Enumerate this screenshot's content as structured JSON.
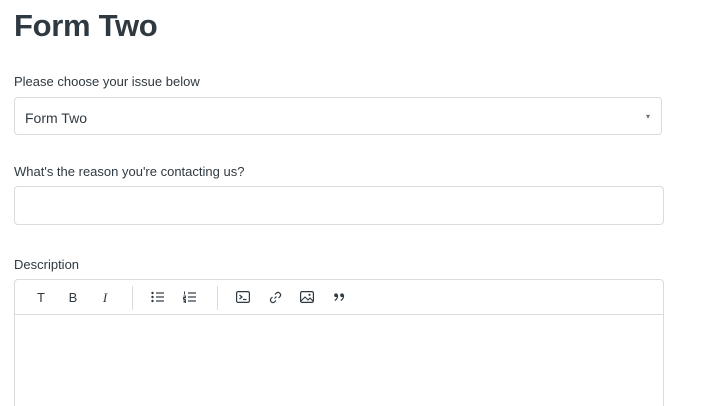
{
  "header": {
    "title": "Form Two"
  },
  "issue_select": {
    "label": "Please choose your issue below",
    "value": "Form Two",
    "caret": "▾"
  },
  "reason_field": {
    "label": "What's the reason you're contacting us?",
    "value": ""
  },
  "description": {
    "label": "Description",
    "toolbar": {
      "text_style": "T",
      "bold": "B",
      "italic": "I"
    },
    "icons": [
      "text-icon",
      "bold-icon",
      "italic-icon",
      "bulleted-list-icon",
      "numbered-list-icon",
      "code-block-icon",
      "link-icon",
      "image-icon",
      "quote-icon"
    ],
    "body": ""
  }
}
